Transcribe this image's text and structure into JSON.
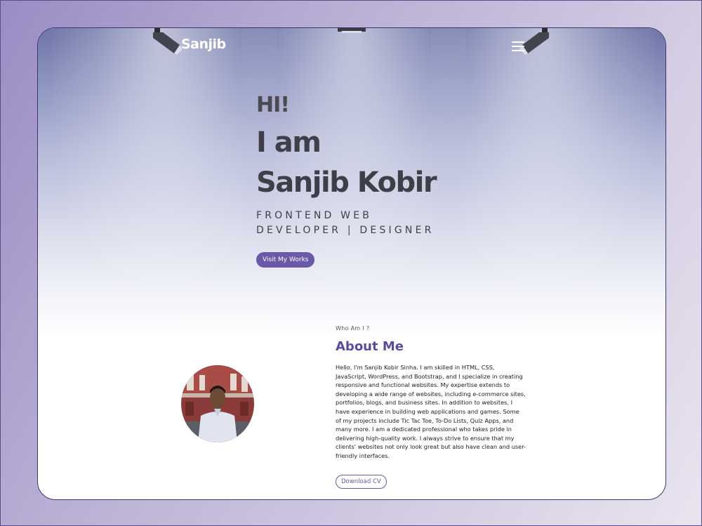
{
  "header": {
    "logo_text": "Sanjib",
    "menu_icon": "hamburger-menu-icon"
  },
  "hero": {
    "greeting": "HI!",
    "intro": "I am",
    "name": "Sanjib Kobir",
    "role_line1": "FRONTEND WEB",
    "role_line2": "DEVELOPER | DESIGNER",
    "cta_label": "Visit My Works"
  },
  "about": {
    "kicker": "Who Am I ?",
    "title": "About Me",
    "body": "Hello, I'm Sanjib Kobir Sinha. I am skilled in HTML, CSS, JavaScript, WordPress, and Bootstrap, and I specialize in creating responsive and functional websites. My expertise extends to developing a wide range of websites, including e-commerce sites, portfolios, blogs, and business sites. In addition to websites, I have experience in building web applications and games. Some of my projects include Tic Tac Toe, To-Do Lists, Quiz Apps, and many more. I am a dedicated professional who takes pride in delivering high-quality work. I always strive to ensure that my clients' websites not only look great but also have clean and user-friendly interfaces.",
    "download_label": "Download CV"
  },
  "colors": {
    "accent": "#6a58a8",
    "title_purple": "#5a4d9e",
    "logo_dot": "#4db3ff",
    "heading_text": "#3f3f47"
  }
}
